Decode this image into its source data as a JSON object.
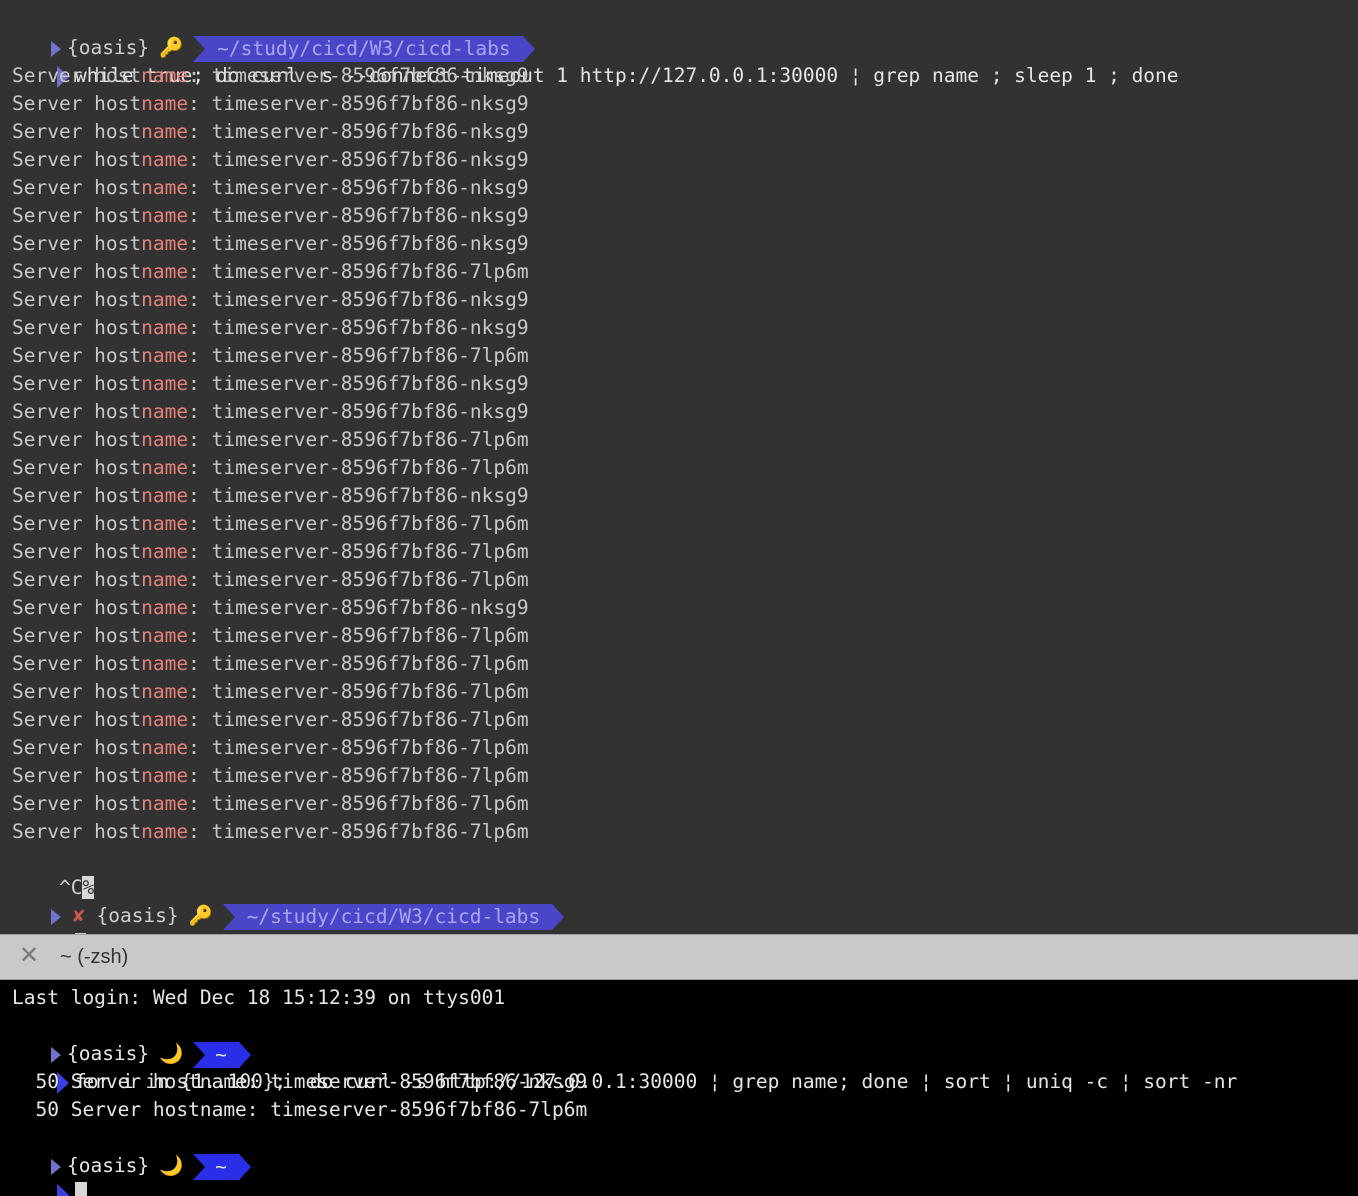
{
  "top": {
    "prompt1": {
      "user": "{oasis}",
      "icon": "key-icon",
      "path": "~/study/cicd/W3/cicd-labs"
    },
    "command": "while true; do curl -s --connect-timeout 1 http://127.0.0.1:30000 ¦ grep name ; sleep 1 ; done",
    "output_prefix": "Server host",
    "output_highlight": "name",
    "output_sep": ": ",
    "output_lines": [
      "timeserver-8596f7bf86-nksg9",
      "timeserver-8596f7bf86-nksg9",
      "timeserver-8596f7bf86-nksg9",
      "timeserver-8596f7bf86-nksg9",
      "timeserver-8596f7bf86-nksg9",
      "timeserver-8596f7bf86-nksg9",
      "timeserver-8596f7bf86-nksg9",
      "timeserver-8596f7bf86-7lp6m",
      "timeserver-8596f7bf86-nksg9",
      "timeserver-8596f7bf86-nksg9",
      "timeserver-8596f7bf86-7lp6m",
      "timeserver-8596f7bf86-nksg9",
      "timeserver-8596f7bf86-nksg9",
      "timeserver-8596f7bf86-7lp6m",
      "timeserver-8596f7bf86-7lp6m",
      "timeserver-8596f7bf86-nksg9",
      "timeserver-8596f7bf86-7lp6m",
      "timeserver-8596f7bf86-7lp6m",
      "timeserver-8596f7bf86-7lp6m",
      "timeserver-8596f7bf86-nksg9",
      "timeserver-8596f7bf86-7lp6m",
      "timeserver-8596f7bf86-7lp6m",
      "timeserver-8596f7bf86-7lp6m",
      "timeserver-8596f7bf86-7lp6m",
      "timeserver-8596f7bf86-7lp6m",
      "timeserver-8596f7bf86-7lp6m",
      "timeserver-8596f7bf86-7lp6m",
      "timeserver-8596f7bf86-7lp6m"
    ],
    "interrupt": "^C",
    "interrupt_pct": "%",
    "prompt2": {
      "status": "✘",
      "user": "{oasis}",
      "icon": "key-icon",
      "path": "~/study/cicd/W3/cicd-labs"
    }
  },
  "tab": {
    "title": "~ (-zsh)",
    "close_icon": "close-icon"
  },
  "bottom": {
    "last_login": "Last login: Wed Dec 18 15:12:39 on ttys001",
    "prompt1": {
      "user": "{oasis}",
      "icon": "moon-icon",
      "path": "~"
    },
    "command": "for i in {1..100};  do curl -s http://127.0.0.1:30000 ¦ grep name; done ¦ sort ¦ uniq -c ¦ sort -nr",
    "results": [
      "  50 Server hostname: timeserver-8596f7bf86-nksg9",
      "  50 Server hostname: timeserver-8596f7bf86-7lp6m"
    ],
    "prompt2": {
      "user": "{oasis}",
      "icon": "moon-icon",
      "path": "~"
    }
  },
  "colors": {
    "prompt_path_bg": "#4a46c8",
    "home_path_bg": "#2a2ee6",
    "highlight": "#e5837a"
  }
}
